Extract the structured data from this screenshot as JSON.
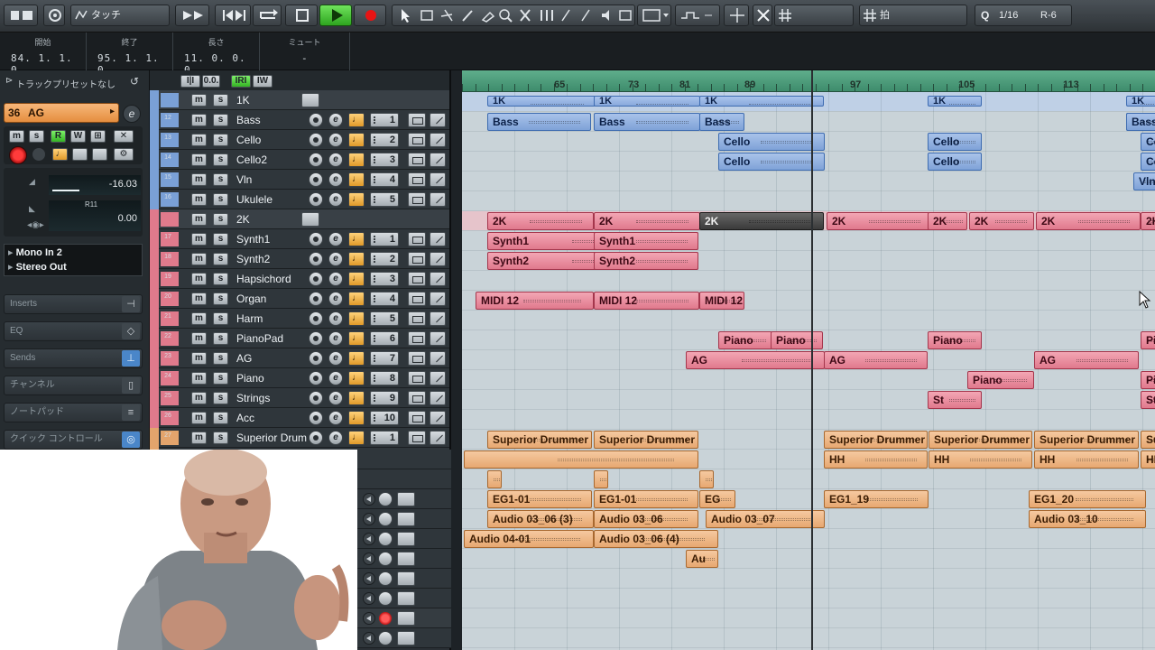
{
  "toolbar": {
    "automation_mode": "タッチ",
    "snap_type": "拍",
    "quantize": "1/16",
    "quantize_mode": "R-6",
    "q_label": "Q"
  },
  "transport_info": {
    "cells": [
      {
        "label": "開始",
        "value": "84. 1. 1.   0"
      },
      {
        "label": "終了",
        "value": "95. 1. 1.   0"
      },
      {
        "label": "長さ",
        "value": "11. 0. 0.   0"
      },
      {
        "label": "ミュート",
        "value": "-"
      }
    ]
  },
  "inspector": {
    "track_preset": "トラックプリセットなし",
    "track_number": "36",
    "track_name": "AG",
    "volume": "-16.03",
    "pan": "0.00",
    "pan_label": "R11",
    "input": "Mono In 2",
    "output": "Stereo Out",
    "sections": [
      "Inserts",
      "EQ",
      "Sends",
      "チャンネル",
      "ノートパッド",
      "クイック コントロール"
    ]
  },
  "tracklist_header": {
    "btn1": "I|I",
    "btn2": "0.0.",
    "btn3": "IRI",
    "btn4": "IW"
  },
  "tracks": [
    {
      "num": "",
      "name": "1K",
      "type": "folder",
      "color": "#7aa0d6"
    },
    {
      "num": "12",
      "name": "Bass",
      "channel": "1",
      "color": "#7aa0d6"
    },
    {
      "num": "13",
      "name": "Cello",
      "channel": "2",
      "color": "#7aa0d6"
    },
    {
      "num": "14",
      "name": "Cello2",
      "channel": "3",
      "color": "#7aa0d6"
    },
    {
      "num": "15",
      "name": "Vln",
      "channel": "4",
      "color": "#7aa0d6"
    },
    {
      "num": "16",
      "name": "Ukulele",
      "channel": "5",
      "color": "#7aa0d6"
    },
    {
      "num": "",
      "name": "2K",
      "type": "folder",
      "color": "#e07a8c"
    },
    {
      "num": "17",
      "name": "Synth1",
      "channel": "1",
      "color": "#e07a8c"
    },
    {
      "num": "18",
      "name": "Synth2",
      "channel": "2",
      "color": "#e07a8c"
    },
    {
      "num": "19",
      "name": "Hapsichord",
      "channel": "3",
      "color": "#e07a8c"
    },
    {
      "num": "20",
      "name": "Organ",
      "channel": "4",
      "color": "#e07a8c"
    },
    {
      "num": "21",
      "name": "Harm",
      "channel": "5",
      "color": "#e07a8c"
    },
    {
      "num": "22",
      "name": "PianoPad",
      "channel": "6",
      "color": "#e07a8c"
    },
    {
      "num": "23",
      "name": "AG",
      "channel": "7",
      "color": "#e07a8c"
    },
    {
      "num": "24",
      "name": "Piano",
      "channel": "8",
      "color": "#e07a8c"
    },
    {
      "num": "25",
      "name": "Strings",
      "channel": "9",
      "color": "#e07a8c"
    },
    {
      "num": "26",
      "name": "Acc",
      "channel": "10",
      "color": "#e07a8c"
    },
    {
      "num": "27",
      "name": "Superior Drum",
      "channel": "1",
      "color": "#e3a46c"
    },
    {
      "num": "",
      "name": "",
      "channel": "1",
      "color": "#e3a46c"
    },
    {
      "num": "",
      "name": "",
      "channel": "1",
      "color": "#e3a46c"
    }
  ],
  "ruler": {
    "bars": [
      "65",
      "73",
      "81",
      "89",
      "97",
      "105",
      "113"
    ]
  },
  "events": [
    {
      "lane": 0,
      "text": "1K",
      "color": "blue"
    },
    {
      "lane": 0,
      "text": "1K",
      "color": "blue"
    },
    {
      "lane": 0,
      "text": "1K",
      "color": "blue"
    },
    {
      "lane": 0,
      "text": "1K",
      "color": "blue"
    },
    {
      "lane": 0,
      "text": "1K",
      "color": "blue"
    },
    {
      "lane": 1,
      "text": "Bass",
      "color": "blue"
    },
    {
      "lane": 1,
      "text": "Bass",
      "color": "blue"
    },
    {
      "lane": 1,
      "text": "Bass",
      "color": "blue"
    },
    {
      "lane": 1,
      "text": "Bass",
      "color": "blue"
    },
    {
      "lane": 1,
      "text": "Bass",
      "color": "blue"
    },
    {
      "lane": 2,
      "text": "Cello",
      "color": "blue"
    },
    {
      "lane": 2,
      "text": "Cello",
      "color": "blue"
    },
    {
      "lane": 2,
      "text": "Ce",
      "color": "blue"
    },
    {
      "lane": 3,
      "text": "Cello",
      "color": "blue"
    },
    {
      "lane": 3,
      "text": "Cello",
      "color": "blue"
    },
    {
      "lane": 3,
      "text": "Ce",
      "color": "blue"
    },
    {
      "lane": 4,
      "text": "Vln",
      "color": "blue"
    },
    {
      "lane": 6,
      "text": "2K",
      "color": "red"
    },
    {
      "lane": 6,
      "text": "2K",
      "color": "red"
    },
    {
      "lane": 6,
      "text": "2K",
      "color": "sel"
    },
    {
      "lane": 6,
      "text": "2K",
      "color": "red"
    },
    {
      "lane": 6,
      "text": "2K",
      "color": "red"
    },
    {
      "lane": 6,
      "text": "2K",
      "color": "red"
    },
    {
      "lane": 6,
      "text": "2K",
      "color": "red"
    },
    {
      "lane": 6,
      "text": "2K",
      "color": "red"
    },
    {
      "lane": 7,
      "text": "Synth1",
      "color": "red"
    },
    {
      "lane": 7,
      "text": "Synth1",
      "color": "red"
    },
    {
      "lane": 8,
      "text": "Synth2",
      "color": "red"
    },
    {
      "lane": 8,
      "text": "Synth2",
      "color": "red"
    },
    {
      "lane": 10,
      "text": "MIDI 12",
      "color": "red"
    },
    {
      "lane": 10,
      "text": "MIDI 12",
      "color": "red"
    },
    {
      "lane": 10,
      "text": "MIDI 12",
      "color": "red"
    },
    {
      "lane": 12,
      "text": "Piano",
      "color": "red"
    },
    {
      "lane": 12,
      "text": "Piano",
      "color": "red"
    },
    {
      "lane": 12,
      "text": "Piano",
      "color": "red"
    },
    {
      "lane": 12,
      "text": "Pi",
      "color": "red"
    },
    {
      "lane": 13,
      "text": "AG",
      "color": "red"
    },
    {
      "lane": 13,
      "text": "AG",
      "color": "red"
    },
    {
      "lane": 13,
      "text": "AG",
      "color": "red"
    },
    {
      "lane": 14,
      "text": "Piano",
      "color": "red"
    },
    {
      "lane": 14,
      "text": "Pi",
      "color": "red"
    },
    {
      "lane": 15,
      "text": "St",
      "color": "red"
    },
    {
      "lane": 15,
      "text": "St",
      "color": "red"
    },
    {
      "lane": 17,
      "text": "Superior Drummer 1",
      "color": "org"
    },
    {
      "lane": 17,
      "text": "Superior Drummer 1",
      "color": "org"
    },
    {
      "lane": 17,
      "text": "Superior Drummer 1",
      "color": "org"
    },
    {
      "lane": 17,
      "text": "Superior Drummer 1",
      "color": "org"
    },
    {
      "lane": 17,
      "text": "Superior Drummer 1",
      "color": "org"
    },
    {
      "lane": 17,
      "text": "Su",
      "color": "org"
    },
    {
      "lane": 18,
      "text": "",
      "color": "org"
    },
    {
      "lane": 18,
      "text": "HH",
      "color": "org"
    },
    {
      "lane": 18,
      "text": "HH",
      "color": "org"
    },
    {
      "lane": 18,
      "text": "HH",
      "color": "org"
    },
    {
      "lane": 18,
      "text": "HH",
      "color": "org"
    },
    {
      "lane": 19,
      "text": "",
      "color": "org"
    },
    {
      "lane": 19,
      "text": "",
      "color": "org"
    },
    {
      "lane": 19,
      "text": "",
      "color": "org"
    },
    {
      "lane": 20,
      "text": "EG1-01",
      "color": "org"
    },
    {
      "lane": 20,
      "text": "EG1-01",
      "color": "org"
    },
    {
      "lane": 20,
      "text": "EG",
      "color": "org"
    },
    {
      "lane": 20,
      "text": "EG1_19",
      "color": "org"
    },
    {
      "lane": 20,
      "text": "EG1_20",
      "color": "org"
    },
    {
      "lane": 21,
      "text": "Audio 03_06 (3)",
      "color": "org"
    },
    {
      "lane": 21,
      "text": "Audio 03_06",
      "color": "org"
    },
    {
      "lane": 21,
      "text": "Audio 03_07",
      "color": "org"
    },
    {
      "lane": 21,
      "text": "Audio 03_10",
      "color": "org"
    },
    {
      "lane": 22,
      "text": "Audio 04-01",
      "color": "org"
    },
    {
      "lane": 22,
      "text": "Audio 03_06 (4)",
      "color": "org"
    },
    {
      "lane": 23,
      "text": "Au",
      "color": "org"
    }
  ]
}
